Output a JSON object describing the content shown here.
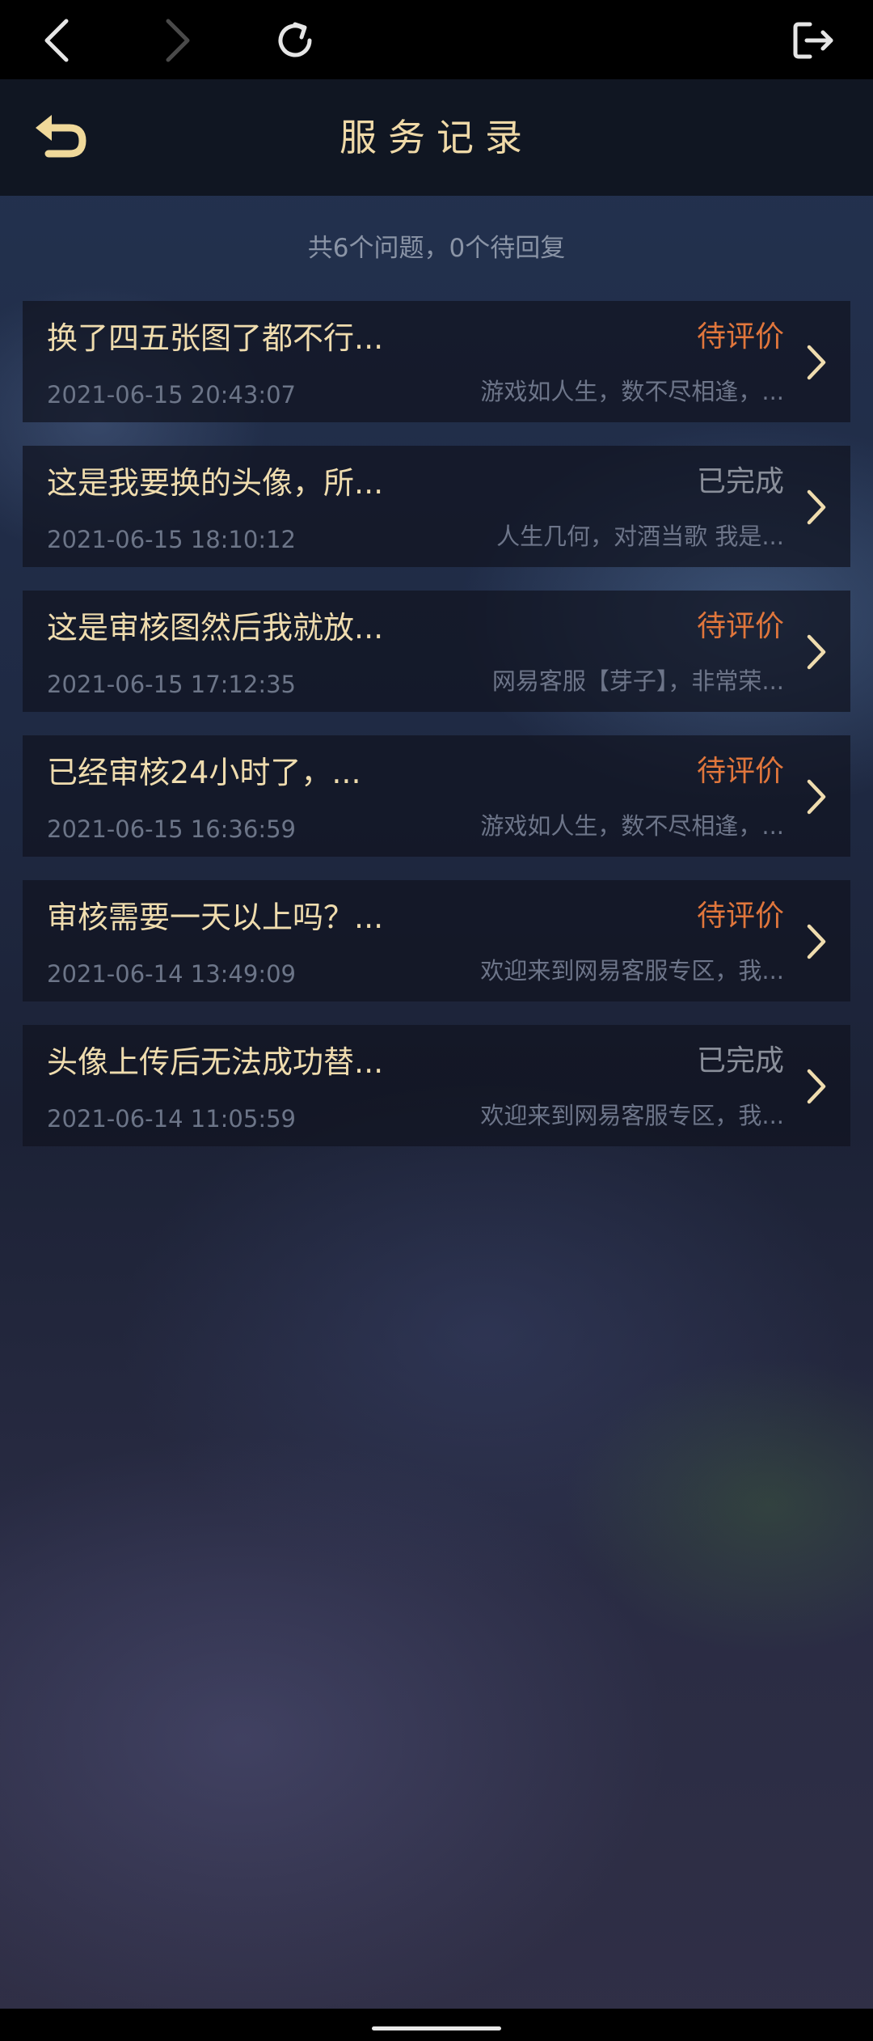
{
  "browser": {
    "icons": [
      "back-icon",
      "forward-icon",
      "reload-icon",
      "exit-icon"
    ]
  },
  "header": {
    "title": "服务记录",
    "back_icon": "return-arrow-icon"
  },
  "summary": "共6个问题，0个待回复",
  "colors": {
    "accent_text": "#efdcae",
    "pending": "#e0763c",
    "done": "#8a8f9a"
  },
  "records": [
    {
      "question": "换了四五张图了都不行...",
      "date": "2021-06-15 20:43:07",
      "status": "待评价",
      "status_type": "pending",
      "reply": "游戏如人生，数不尽相逢，..."
    },
    {
      "question": "这是我要换的头像，所...",
      "date": "2021-06-15 18:10:12",
      "status": "已完成",
      "status_type": "done",
      "reply": "人生几何，对酒当歌 我是..."
    },
    {
      "question": "这是审核图然后我就放...",
      "date": "2021-06-15 17:12:35",
      "status": "待评价",
      "status_type": "pending",
      "reply": "网易客服【芽子】，非常荣..."
    },
    {
      "question": "已经审核24小时了，...",
      "date": "2021-06-15 16:36:59",
      "status": "待评价",
      "status_type": "pending",
      "reply": "游戏如人生，数不尽相逢，..."
    },
    {
      "question": "审核需要一天以上吗？...",
      "date": "2021-06-14 13:49:09",
      "status": "待评价",
      "status_type": "pending",
      "reply": "欢迎来到网易客服专区，我..."
    },
    {
      "question": "头像上传后无法成功替...",
      "date": "2021-06-14 11:05:59",
      "status": "已完成",
      "status_type": "done",
      "reply": "欢迎来到网易客服专区，我..."
    }
  ]
}
